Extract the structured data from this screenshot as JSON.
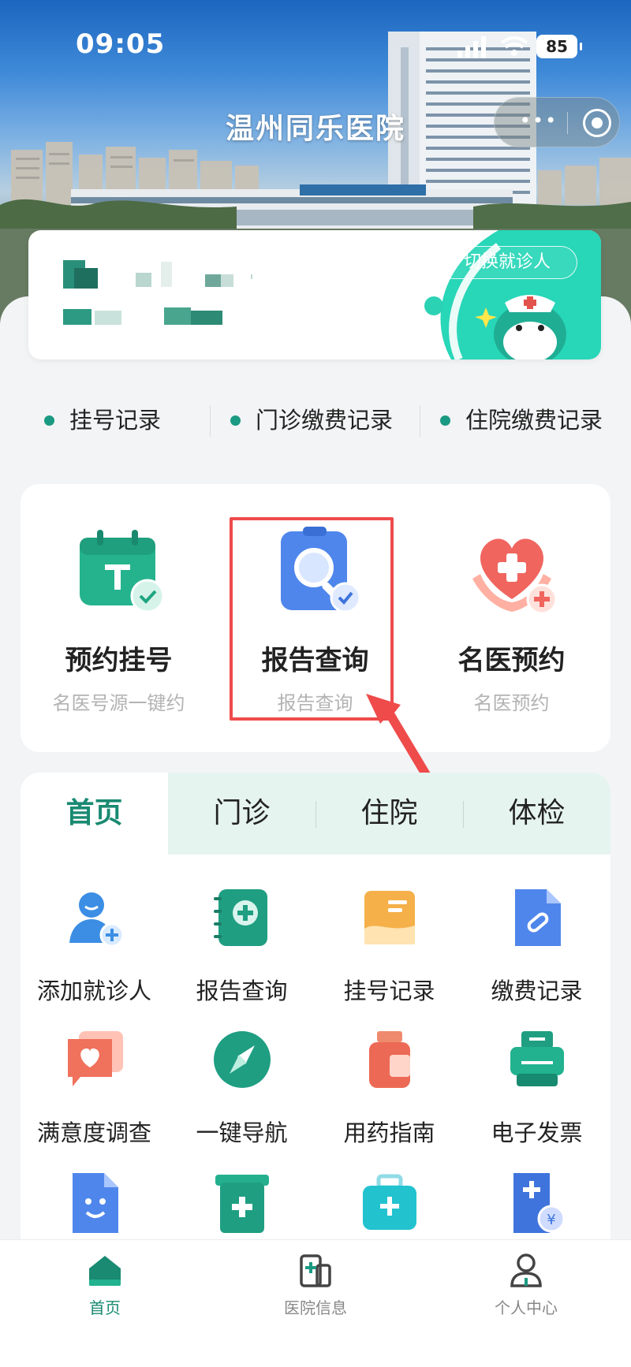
{
  "status_bar": {
    "time": "09:05",
    "battery": "85"
  },
  "header": {
    "title": "温州同乐医院"
  },
  "patient_card": {
    "switch_label": "切换就诊人"
  },
  "records": [
    {
      "label": "挂号记录"
    },
    {
      "label": "门诊缴费记录"
    },
    {
      "label": "住院缴费记录"
    }
  ],
  "services": [
    {
      "title": "预约挂号",
      "subtitle": "名医号源一键约",
      "icon": "calendar-check-icon"
    },
    {
      "title": "报告查询",
      "subtitle": "报告查询",
      "icon": "report-search-icon"
    },
    {
      "title": "名医预约",
      "subtitle": "名医预约",
      "icon": "heart-hands-icon"
    }
  ],
  "tabs": [
    {
      "label": "首页",
      "active": true
    },
    {
      "label": "门诊",
      "active": false
    },
    {
      "label": "住院",
      "active": false
    },
    {
      "label": "体检",
      "active": false
    }
  ],
  "grid": [
    {
      "label": "添加就诊人",
      "icon": "add-person-icon"
    },
    {
      "label": "报告查询",
      "icon": "notebook-plus-icon"
    },
    {
      "label": "挂号记录",
      "icon": "image-card-icon"
    },
    {
      "label": "缴费记录",
      "icon": "link-document-icon"
    },
    {
      "label": "满意度调查",
      "icon": "heart-chat-icon"
    },
    {
      "label": "一键导航",
      "icon": "compass-icon"
    },
    {
      "label": "用药指南",
      "icon": "medicine-bottle-icon"
    },
    {
      "label": "电子发票",
      "icon": "printer-icon"
    },
    {
      "label": "",
      "icon": "smile-document-icon"
    },
    {
      "label": "",
      "icon": "medical-box-icon"
    },
    {
      "label": "",
      "icon": "first-aid-kit-icon"
    },
    {
      "label": "",
      "icon": "medical-bill-icon"
    }
  ],
  "bottom_nav": [
    {
      "label": "首页",
      "icon": "home-icon",
      "active": true
    },
    {
      "label": "医院信息",
      "icon": "hospital-info-icon",
      "active": false
    },
    {
      "label": "个人中心",
      "icon": "user-center-icon",
      "active": false
    }
  ],
  "colors": {
    "accent": "#1a8a72",
    "highlight": "#ef4b4b",
    "tab_bg": "#e6f4f0"
  }
}
